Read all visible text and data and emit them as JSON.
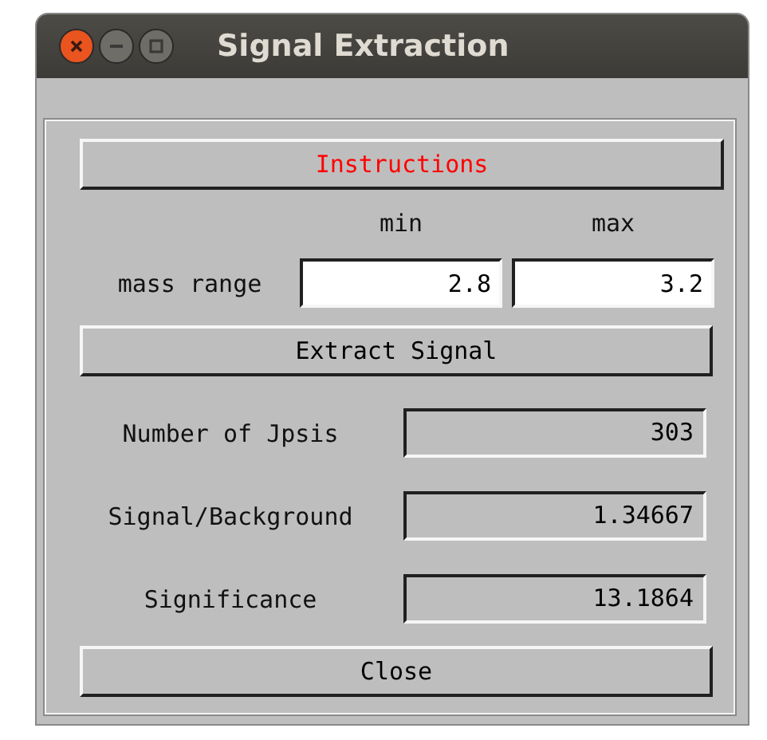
{
  "window": {
    "title": "Signal Extraction"
  },
  "instructions_button": "Instructions",
  "range_headers": [
    "min",
    "max"
  ],
  "mass_range": {
    "label": "mass range",
    "min": "2.8",
    "max": "3.2"
  },
  "extract_button": "Extract Signal",
  "results": [
    {
      "label": "Number of Jpsis",
      "value": "303"
    },
    {
      "label": "Signal/Background",
      "value": "1.34667"
    },
    {
      "label": "Significance",
      "value": "13.1864"
    }
  ],
  "close_button": "Close"
}
